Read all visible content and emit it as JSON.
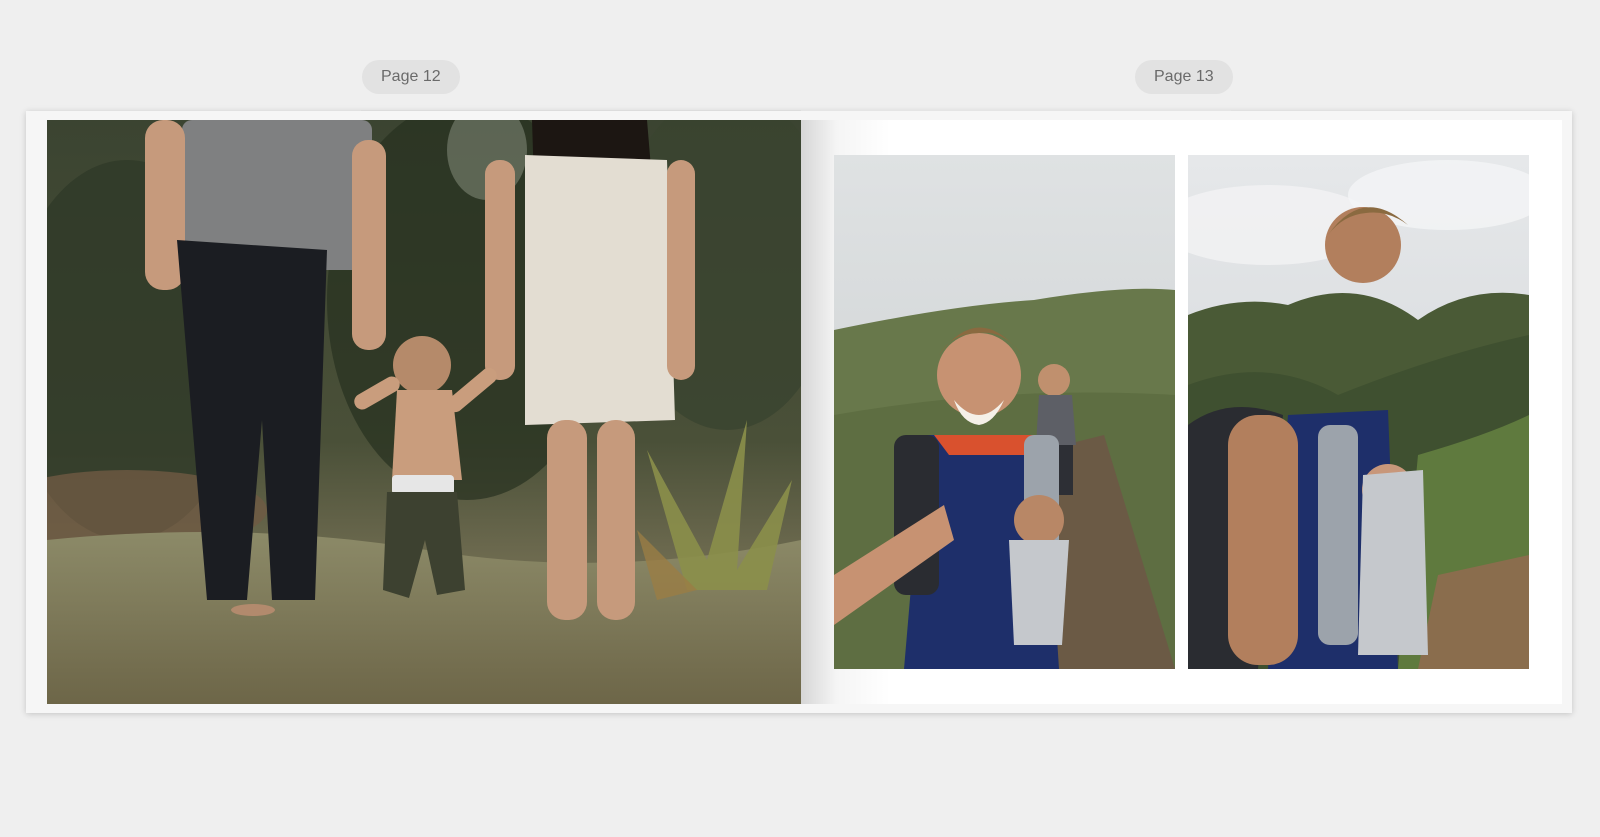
{
  "spread": {
    "left_page_label": "Page 12",
    "right_page_label": "Page 13"
  },
  "colors": {
    "background": "#efefef",
    "label_bg": "#e2e2e2",
    "label_text": "#6a6a6a",
    "page_white": "#ffffff"
  }
}
